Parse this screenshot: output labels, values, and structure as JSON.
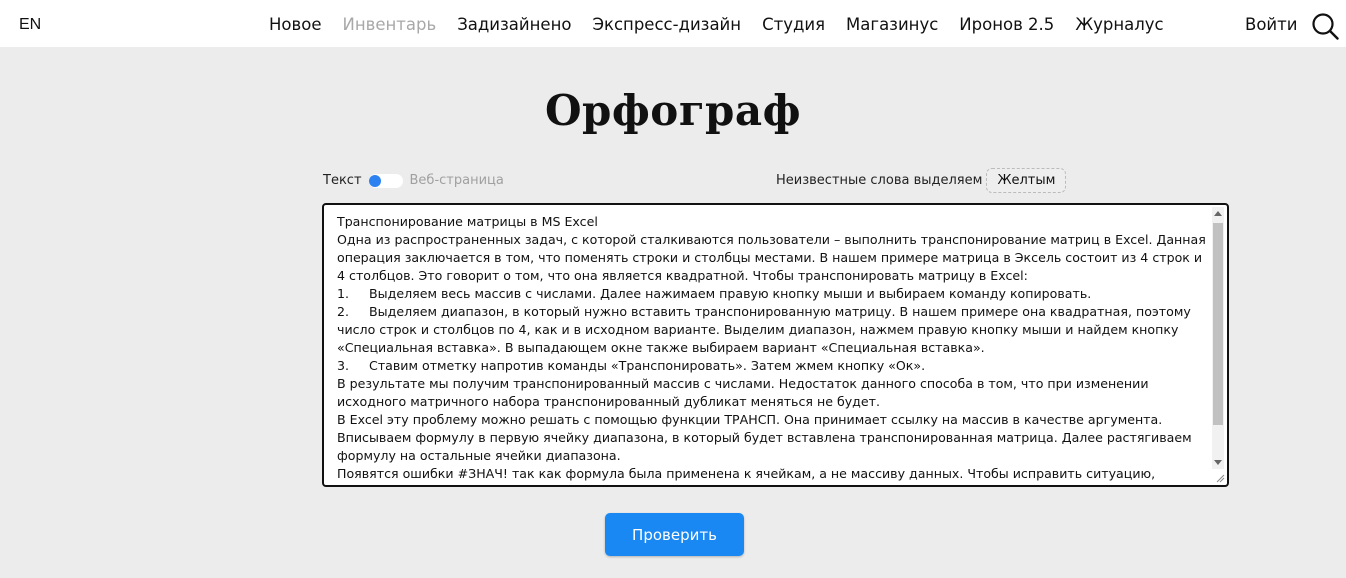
{
  "header": {
    "lang": "EN",
    "nav": [
      {
        "label": "Новое",
        "muted": false
      },
      {
        "label": "Инвентарь",
        "muted": true
      },
      {
        "label": "Задизайнено",
        "muted": false
      },
      {
        "label": "Экспресс-дизайн",
        "muted": false
      },
      {
        "label": "Студия",
        "muted": false
      },
      {
        "label": "Магазинус",
        "muted": false
      },
      {
        "label": "Иронов 2.5",
        "muted": false
      },
      {
        "label": "Журналус",
        "muted": false
      }
    ],
    "login": "Войти",
    "search_icon": "search-icon"
  },
  "title": "Орфограф",
  "mode": {
    "text_label": "Текст",
    "web_label": "Веб-страница"
  },
  "highlight": {
    "label": "Неизвестные слова выделяем",
    "value": "Желтым"
  },
  "editor": {
    "value": "Транспонирование матрицы в MS Excel\nОдна из распространенных задач, с которой сталкиваются пользователи – выполнить транспонирование матриц в Excel. Данная операция заключается в том, что поменять строки и столбцы местами. В нашем примере матрица в Эксель состоит из 4 строк и 4 столбцов. Это говорит о том, что она является квадратной. Чтобы транспонировать матрицу в Excel:\n1.     Выделяем весь массив с числами. Далее нажимаем правую кнопку мыши и выбираем команду копировать.\n2.     Выделяем диапазон, в который нужно вставить транспонированную матрицу. В нашем примере она квадратная, поэтому число строк и столбцов по 4, как и в исходном варианте. Выделим диапазон, нажмем правую кнопку мыши и найдем кнопку «Специальная вставка». В выпадающем окне также выбираем вариант «Специальная вставка».\n3.     Ставим отметку напротив команды «Транспонировать». Затем жмем кнопку «Ок».\nВ результате мы получим транспонированный массив с числами. Недостаток данного способа в том, что при изменении исходного матричного набора транспонированный дубликат меняться не будет.\nВ Excel эту проблему можно решать с помощью функции ТРАНСП. Она принимает ссылку на массив в качестве аргумента. Вписываем формулу в первую ячейку диапазона, в который будет вставлена транспонированная матрица. Далее растягиваем формулу на остальные ячейки диапазона.\nПоявятся ошибки #ЗНАЧ! так как формула была применена к ячейкам, а не массиву данных. Чтобы исправить ситуацию, выделяем этот"
  },
  "check_button": "Проверить",
  "colors": {
    "accent": "#1a88f3",
    "background": "#ececec",
    "muted_nav": "#a8a8a8"
  }
}
